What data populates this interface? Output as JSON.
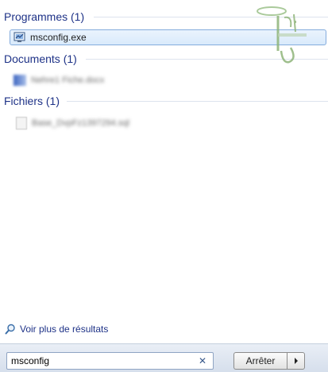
{
  "sections": {
    "programs": {
      "title": "Programmes (1)"
    },
    "documents": {
      "title": "Documents (1)"
    },
    "files": {
      "title": "Fichiers (1)"
    }
  },
  "programs": {
    "items": [
      {
        "label": "msconfig.exe",
        "icon": "msconfig-icon",
        "selected": true
      }
    ]
  },
  "documents": {
    "items": [
      {
        "label": "Nehre1 Fiche.docx",
        "blurred": true
      }
    ]
  },
  "files": {
    "items": [
      {
        "label": "Base_DvpFz1397294.sql",
        "blurred": true
      }
    ]
  },
  "more_results": {
    "label": "Voir plus de résultats",
    "icon": "magnifier-icon"
  },
  "search": {
    "value": "msconfig",
    "clear_icon": "close-icon"
  },
  "shutdown": {
    "label": "Arrêter",
    "arrow_icon": "chevron-right-icon"
  },
  "colors": {
    "header_text": "#1e3287",
    "selection_border": "#84acdd",
    "selection_fill": "#dcebfc",
    "bottom_bar": "#dfe6f0"
  }
}
